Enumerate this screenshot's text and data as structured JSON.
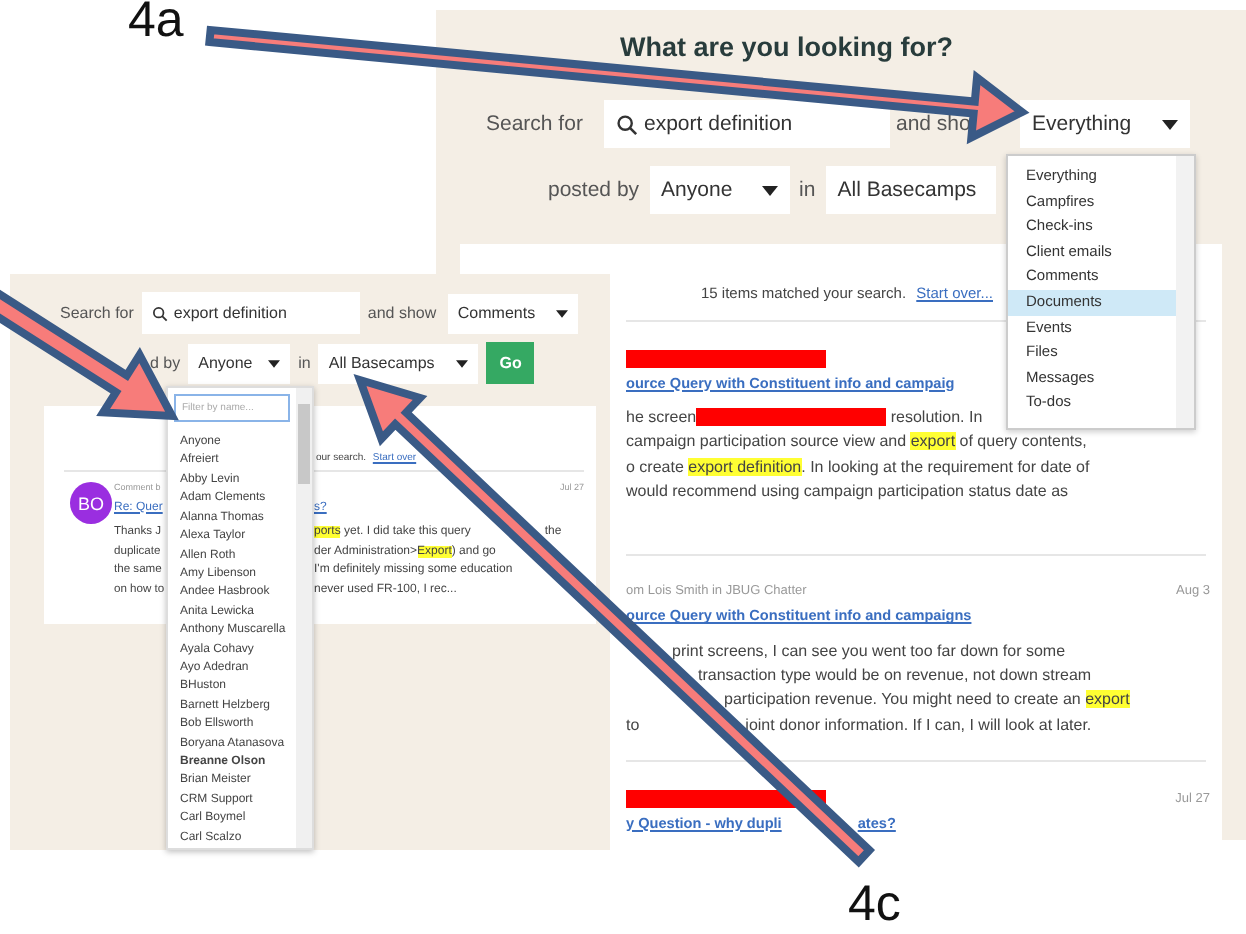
{
  "annotations": [
    {
      "label": "4a"
    },
    {
      "label": "4c"
    }
  ],
  "back_screen": {
    "heading": "What are you looking for?",
    "search_label": "Search for",
    "search_value": "export definition",
    "show_label": "and sho",
    "show_select": "Everything",
    "posted_by_label": "posted by",
    "posted_by_select": "Anyone",
    "in_label": "in",
    "basecamp_select": "All Basecamps",
    "type_menu": [
      {
        "label": "Everything",
        "selected": false
      },
      {
        "label": "Campfires",
        "selected": false
      },
      {
        "label": "Check-ins",
        "selected": false
      },
      {
        "label": "Client emails",
        "selected": false
      },
      {
        "label": "Comments",
        "selected": false
      },
      {
        "label": "Documents",
        "selected": true
      },
      {
        "label": "Events",
        "selected": false
      },
      {
        "label": "Files",
        "selected": false
      },
      {
        "label": "Messages",
        "selected": false
      },
      {
        "label": "To-dos",
        "selected": false
      }
    ],
    "summary": {
      "text": "15 items matched your search.",
      "link": "Start over..."
    },
    "results": [
      {
        "redacted": true,
        "title": [
          "ource Query with Constituent info and campaig"
        ],
        "lines": [
          [
            {
              "kind": "text",
              "text": "he screen"
            },
            {
              "kind": "redaction"
            },
            {
              "kind": "text",
              "text": " resolution. In"
            }
          ],
          [
            {
              "kind": "text",
              "text": "campaign participation source view and "
            },
            {
              "kind": "highlight",
              "text": "export"
            },
            {
              "kind": "text",
              "text": " of query contents,"
            }
          ],
          [
            {
              "kind": "text",
              "text": "o create "
            },
            {
              "kind": "highlight",
              "text": "export definition"
            },
            {
              "kind": "text",
              "text": ". In looking at the requirement for date of"
            }
          ],
          [
            {
              "kind": "text",
              "text": "would recommend using campaign participation status date as"
            }
          ]
        ]
      },
      {
        "redacted": false,
        "meta": "om Lois Smith in JBUG Chatter",
        "date": "Aug 3",
        "title": [
          "ource Query with Constituent info and campaigns"
        ],
        "lines": [
          [
            {
              "kind": "text",
              "text": "print screens, I can see you went too far down for some"
            }
          ],
          [
            {
              "kind": "text",
              "text": "transaction type would be on revenue, not down stream"
            }
          ],
          [
            {
              "kind": "text",
              "text": "participation revenue. You might need to create an "
            },
            {
              "kind": "highlight",
              "text": "export"
            }
          ],
          [
            {
              "kind": "text",
              "text": "to"
            },
            {
              "kind": "text",
              "text": "joint donor information. If I can, I will look at later."
            }
          ]
        ]
      },
      {
        "redacted": true,
        "date": "Jul 27",
        "title": [
          "y Question - why dupli",
          "ates?"
        ]
      }
    ]
  },
  "front_screen": {
    "search_label": "Search for",
    "search_value": "export definition",
    "show_label": "and show",
    "show_select": "Comments",
    "posted_by_label": "d by",
    "posted_by_select": "Anyone",
    "in_label": "in",
    "basecamp_select": "All Basecamps",
    "go_button": "Go",
    "summary": {
      "text": "our search.",
      "link": "Start over"
    },
    "result": {
      "avatar": "BO",
      "meta": "Comment b",
      "date": "Jul 27",
      "title_left": "Re: Quer",
      "title_right": "s?",
      "lines": [
        {
          "left": "Thanks J",
          "right": [
            {
              "kind": "highlight",
              "text": "ports"
            },
            {
              "kind": "text",
              "text": " yet. I did take this query"
            },
            {
              "kind": "text",
              "text": "the"
            }
          ]
        },
        {
          "left": "duplicate",
          "right": [
            {
              "kind": "text",
              "text": "der Administration>"
            },
            {
              "kind": "highlight",
              "text": "Export"
            },
            {
              "kind": "text",
              "text": ") and go"
            }
          ]
        },
        {
          "left": "the same",
          "right": [
            {
              "kind": "text",
              "text": "I'm definitely missing some education"
            }
          ]
        },
        {
          "left": "on how to",
          "right": [
            {
              "kind": "text",
              "text": "never used FR-100, I rec..."
            }
          ]
        }
      ]
    },
    "people_menu": {
      "placeholder": "Filter by name...",
      "people": [
        {
          "name": "Anyone",
          "selected": false
        },
        {
          "name": "Afreiert",
          "selected": false
        },
        {
          "name": "Abby Levin",
          "selected": false
        },
        {
          "name": "Adam Clements",
          "selected": false
        },
        {
          "name": "Alanna Thomas",
          "selected": false
        },
        {
          "name": "Alexa Taylor",
          "selected": false
        },
        {
          "name": "Allen Roth",
          "selected": false
        },
        {
          "name": "Amy Libenson",
          "selected": false
        },
        {
          "name": "Andee Hasbrook",
          "selected": false
        },
        {
          "name": "Anita Lewicka",
          "selected": false
        },
        {
          "name": "Anthony Muscarella",
          "selected": false
        },
        {
          "name": "Ayala Cohavy",
          "selected": false
        },
        {
          "name": "Ayo Adedran",
          "selected": false
        },
        {
          "name": "BHuston",
          "selected": false
        },
        {
          "name": "Barnett Helzberg",
          "selected": false
        },
        {
          "name": "Bob Ellsworth",
          "selected": false
        },
        {
          "name": "Boryana Atanasova",
          "selected": false
        },
        {
          "name": "Breanne Olson",
          "selected": true
        },
        {
          "name": "Brian Meister",
          "selected": false
        },
        {
          "name": "CRM Support",
          "selected": false
        },
        {
          "name": "Carl Boymel",
          "selected": false
        },
        {
          "name": "Carl Scalzo",
          "selected": false
        }
      ]
    }
  }
}
